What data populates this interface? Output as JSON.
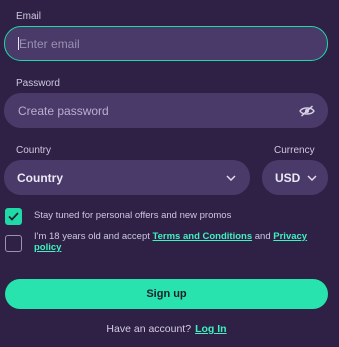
{
  "email": {
    "label": "Email",
    "placeholder": "Enter email"
  },
  "password": {
    "label": "Password",
    "placeholder": "Create password",
    "toggle_icon": "eye-slash-icon"
  },
  "country": {
    "label": "Country",
    "value": "Country"
  },
  "currency": {
    "label": "Currency",
    "value": "USD"
  },
  "promos": {
    "checked": true,
    "text": "Stay tuned for personal offers and new promos"
  },
  "terms": {
    "checked": false,
    "text_before": "I'm 18 years old and accept ",
    "terms_link": "Terms and Conditions",
    "text_and": " and ",
    "privacy_link": "Privacy policy"
  },
  "signup_label": "Sign up",
  "login": {
    "prompt": "Have an account?",
    "link": "Log In"
  },
  "colors": {
    "background": "#2e2145",
    "field": "#4a3a6a",
    "accent": "#28e3ae"
  }
}
